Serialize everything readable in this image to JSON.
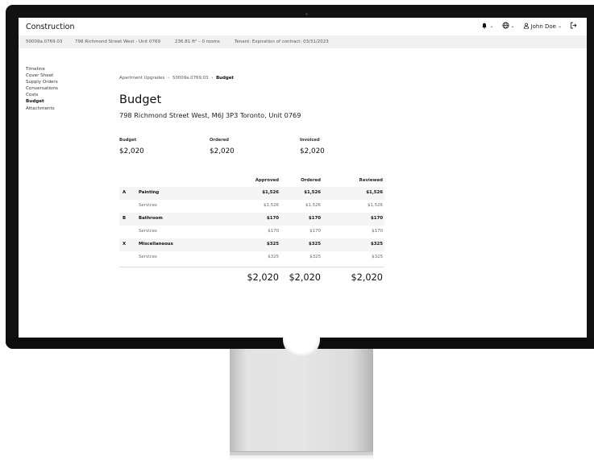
{
  "app": {
    "title": "Construction",
    "user_name": "John Doe"
  },
  "subbar": {
    "project_id": "50009a.0769.03",
    "address": "798 Richmond Street West - Unit 0769",
    "area": "236.81 ft² – 0 rooms",
    "tenant": "Tenant: Expiration of contract: 03/31/2023"
  },
  "sidebar": {
    "items": [
      {
        "label": "Timeline"
      },
      {
        "label": "Cover Sheet"
      },
      {
        "label": "Supply Orders"
      },
      {
        "label": "Conversations"
      },
      {
        "label": "Costs"
      },
      {
        "label": "Budget"
      },
      {
        "label": "Attachments"
      }
    ]
  },
  "breadcrumb": {
    "root": "Apartment Upgrades",
    "sep": "›",
    "project": "50009a.0769.03",
    "current": "Budget"
  },
  "page": {
    "title": "Budget",
    "address": "798 Richmond Street West, M6J 3P3 Toronto, Unit 0769"
  },
  "summary": {
    "budget_label": "Budget",
    "budget_value": "$2,020",
    "ordered_label": "Ordered",
    "ordered_value": "$2,020",
    "invoiced_label": "Invoiced",
    "invoiced_value": "$2,020"
  },
  "table": {
    "headers": [
      "Approved",
      "Ordered",
      "Reviewed"
    ],
    "rows": [
      {
        "type": "cat",
        "letter": "A",
        "name": "Painting",
        "values": [
          "$1,526",
          "$1,526",
          "$1,526"
        ]
      },
      {
        "type": "sub",
        "letter": "",
        "name": "Services",
        "values": [
          "$1,526",
          "$1,526",
          "$1,526"
        ]
      },
      {
        "type": "cat",
        "letter": "B",
        "name": "Bathroom",
        "values": [
          "$170",
          "$170",
          "$170"
        ]
      },
      {
        "type": "sub",
        "letter": "",
        "name": "Services",
        "values": [
          "$170",
          "$170",
          "$170"
        ]
      },
      {
        "type": "cat",
        "letter": "X",
        "name": "Miscellaneous",
        "values": [
          "$325",
          "$325",
          "$325"
        ]
      },
      {
        "type": "sub",
        "letter": "",
        "name": "Services",
        "values": [
          "$325",
          "$325",
          "$325"
        ]
      }
    ],
    "totals": [
      "$2,020",
      "$2,020",
      "$2,020"
    ]
  },
  "icons": {
    "notifications": "bell-icon",
    "language": "globe-icon",
    "user": "user-icon",
    "logout": "logout-icon"
  }
}
